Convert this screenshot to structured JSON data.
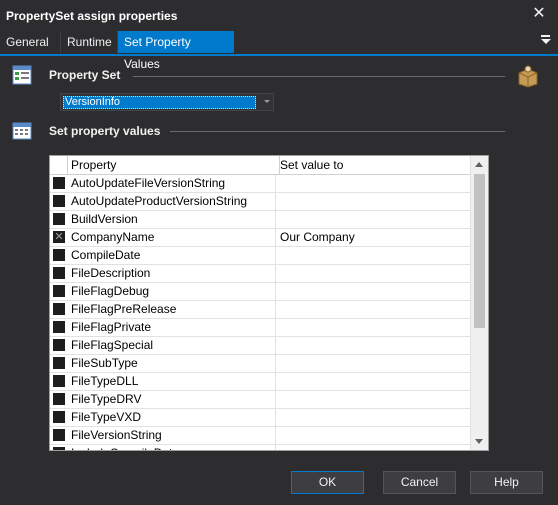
{
  "window": {
    "title": "PropertySet assign properties"
  },
  "tabs": [
    {
      "label": "General"
    },
    {
      "label": "Runtime"
    },
    {
      "label": "Set Property Values"
    }
  ],
  "property_set": {
    "label": "Property Set",
    "selected": "VersionInfo"
  },
  "set_values": {
    "label": "Set property values"
  },
  "grid": {
    "columns": {
      "property": "Property",
      "value": "Set value to"
    },
    "rows": [
      {
        "property": "AutoUpdateFileVersionString",
        "value": "",
        "checked": false
      },
      {
        "property": "AutoUpdateProductVersionString",
        "value": "",
        "checked": false
      },
      {
        "property": "BuildVersion",
        "value": "",
        "checked": false
      },
      {
        "property": "CompanyName",
        "value": "Our Company",
        "checked": true
      },
      {
        "property": "CompileDate",
        "value": "",
        "checked": false
      },
      {
        "property": "FileDescription",
        "value": "",
        "checked": false
      },
      {
        "property": "FileFlagDebug",
        "value": "",
        "checked": false
      },
      {
        "property": "FileFlagPreRelease",
        "value": "",
        "checked": false
      },
      {
        "property": "FileFlagPrivate",
        "value": "",
        "checked": false
      },
      {
        "property": "FileFlagSpecial",
        "value": "",
        "checked": false
      },
      {
        "property": "FileSubType",
        "value": "",
        "checked": false
      },
      {
        "property": "FileTypeDLL",
        "value": "",
        "checked": false
      },
      {
        "property": "FileTypeDRV",
        "value": "",
        "checked": false
      },
      {
        "property": "FileTypeVXD",
        "value": "",
        "checked": false
      },
      {
        "property": "FileVersionString",
        "value": "",
        "checked": false
      },
      {
        "property": "IncludeCompileDate",
        "value": "",
        "checked": false
      }
    ]
  },
  "buttons": {
    "ok": "OK",
    "cancel": "Cancel",
    "help": "Help"
  },
  "colors": {
    "accent": "#007acc",
    "background": "#2d2d30"
  }
}
